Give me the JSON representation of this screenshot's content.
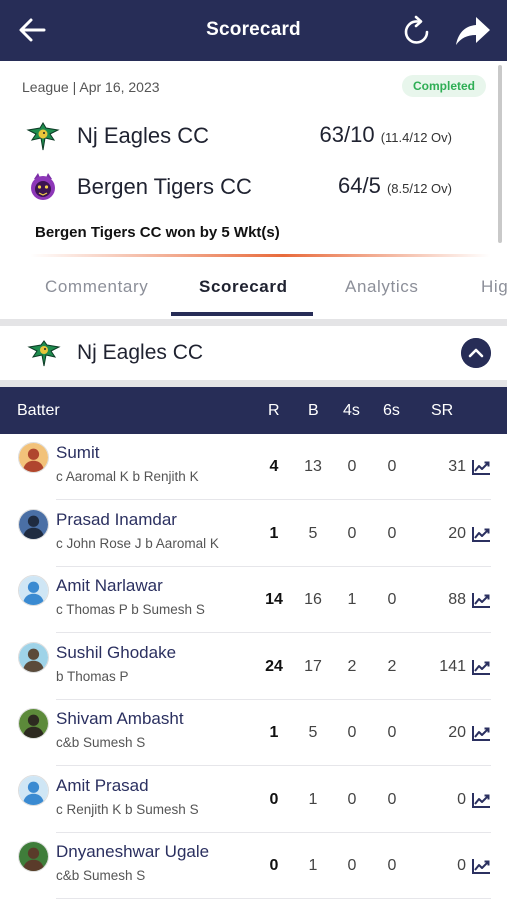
{
  "header": {
    "title": "Scorecard",
    "back_icon": "arrow-left-icon",
    "refresh_icon": "refresh-icon",
    "share_icon": "share-icon",
    "background": "#272d57"
  },
  "match": {
    "meta": "League | Apr 16, 2023",
    "status": "Completed",
    "teams": [
      {
        "name": "Nj Eagles CC",
        "score": "63/10",
        "overs": "(11.4/12 Ov)"
      },
      {
        "name": "Bergen Tigers CC",
        "score": "64/5",
        "overs": "(8.5/12 Ov)"
      }
    ],
    "result": "Bergen Tigers CC won by 5 Wkt(s)"
  },
  "tabs": [
    {
      "label": "Commentary",
      "active": false
    },
    {
      "label": "Scorecard",
      "active": true
    },
    {
      "label": "Analytics",
      "active": false
    },
    {
      "label": "Hig",
      "active": false
    }
  ],
  "innings": {
    "team_name": "Nj Eagles CC",
    "collapse_icon": "chevron-up-icon"
  },
  "table": {
    "columns": [
      "Batter",
      "R",
      "B",
      "4s",
      "6s",
      "SR"
    ],
    "rows": [
      {
        "name": "Sumit",
        "dismissal": "c Aaromal K b Renjith K",
        "r": "4",
        "b": "13",
        "fours": "0",
        "sixes": "0",
        "sr": "31"
      },
      {
        "name": "Prasad Inamdar",
        "dismissal": "c John Rose J b Aaromal K",
        "r": "1",
        "b": "5",
        "fours": "0",
        "sixes": "0",
        "sr": "20"
      },
      {
        "name": "Amit Narlawar",
        "dismissal": "c Thomas P b Sumesh S",
        "r": "14",
        "b": "16",
        "fours": "1",
        "sixes": "0",
        "sr": "88"
      },
      {
        "name": "Sushil Ghodake",
        "dismissal": "b Thomas P",
        "r": "24",
        "b": "17",
        "fours": "2",
        "sixes": "2",
        "sr": "141"
      },
      {
        "name": "Shivam Ambasht",
        "dismissal": "c&b Sumesh S",
        "r": "1",
        "b": "5",
        "fours": "0",
        "sixes": "0",
        "sr": "20"
      },
      {
        "name": "Amit Prasad",
        "dismissal": "c Renjith K b Sumesh S",
        "r": "0",
        "b": "1",
        "fours": "0",
        "sixes": "0",
        "sr": "0"
      },
      {
        "name": "Dnyaneshwar Ugale",
        "dismissal": "c&b Sumesh S",
        "r": "0",
        "b": "1",
        "fours": "0",
        "sixes": "0",
        "sr": "0"
      }
    ],
    "trend_icon": "trend-chart-icon"
  },
  "colors": {
    "accent": "#e86b3c",
    "badge_text": "#2fae55",
    "badge_bg": "#e8f6ec"
  }
}
